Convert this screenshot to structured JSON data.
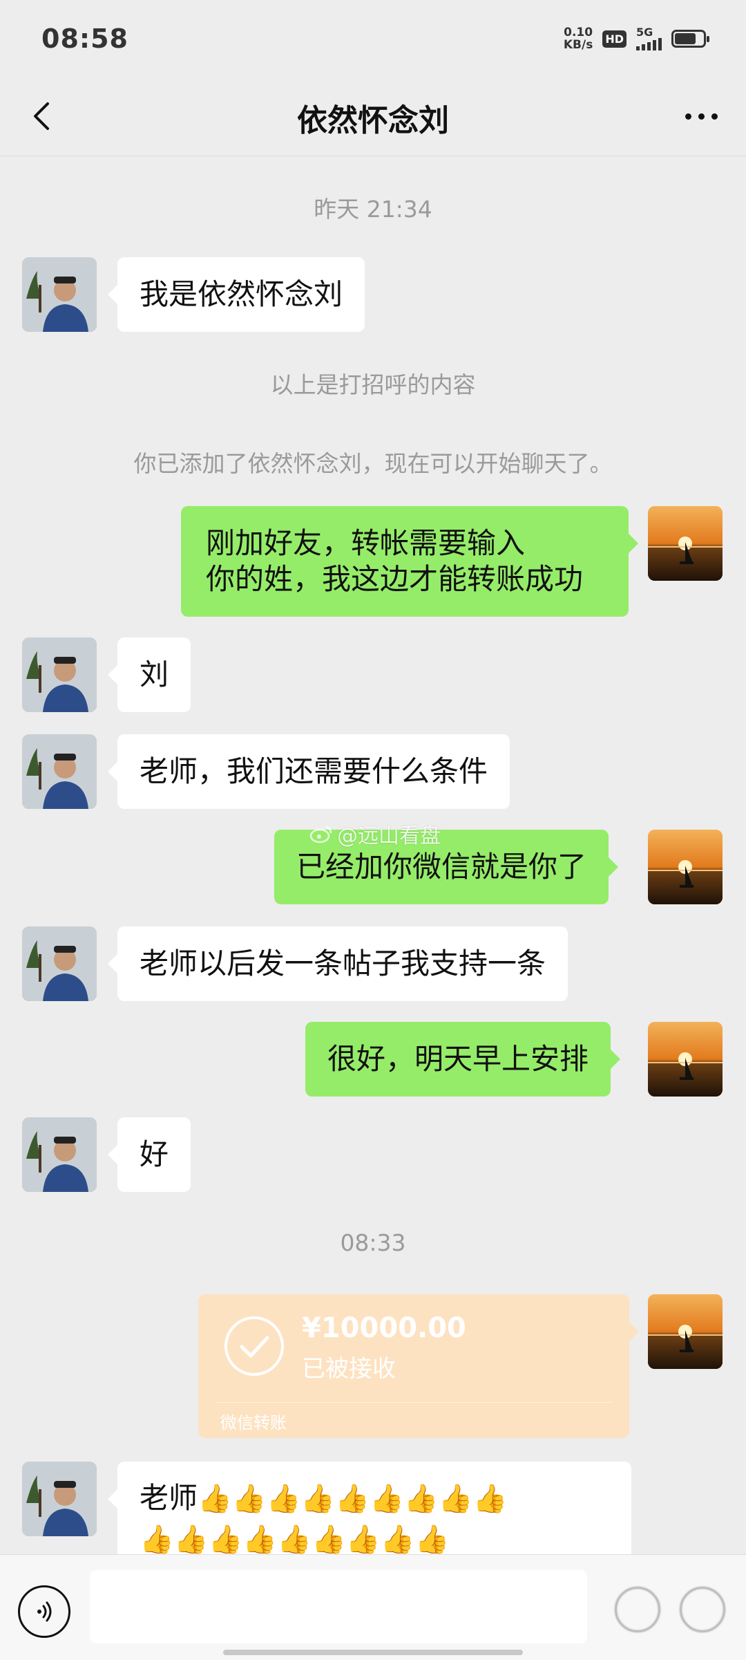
{
  "status_bar": {
    "time": "08:58",
    "net_speed_value": "0.10",
    "net_speed_unit": "KB/s",
    "hd_label": "HD",
    "network": "5G",
    "battery_level": 0.75
  },
  "nav": {
    "title": "依然怀念刘",
    "back_icon": "chevron-left-icon",
    "more_icon": "more-dots-icon"
  },
  "timestamps": {
    "first": "昨天 21:34",
    "second": "08:33"
  },
  "system_messages": {
    "greeting_note": "以上是打招呼的内容",
    "added_note": "你已添加了依然怀念刘，现在可以开始聊天了。"
  },
  "messages": [
    {
      "side": "in",
      "text": "我是依然怀念刘"
    },
    {
      "side": "out",
      "line1": "刚加好友，转帐需要输入",
      "line2": "你的姓，我这边才能转账成功"
    },
    {
      "side": "in",
      "text": "刘"
    },
    {
      "side": "in",
      "text": "老师，我们还需要什么条件"
    },
    {
      "side": "out",
      "text": "已经加你微信就是你了"
    },
    {
      "side": "in",
      "text": "老师以后发一条帖子我支持一条"
    },
    {
      "side": "out",
      "text": "很好，明天早上安排"
    },
    {
      "side": "in",
      "text": "好"
    },
    {
      "side": "in",
      "text": "老师",
      "emoji_line1": "👍👍👍👍👍👍👍👍👍",
      "emoji_line2": "👍👍👍👍👍👍👍👍👍"
    }
  ],
  "transfer": {
    "amount": "¥10000.00",
    "status": "已被接收",
    "label": "微信转账",
    "icon": "check-circle-icon",
    "color": "#fde2c2"
  },
  "watermark": {
    "text": "@远山看盘",
    "icon": "weibo-icon"
  },
  "colors": {
    "background": "#ededed",
    "incoming_bubble": "#ffffff",
    "outgoing_bubble": "#95ec69"
  },
  "input_bar": {
    "voice_icon": "voice-icon",
    "emoji_icon": "emoji-icon",
    "plus_icon": "plus-icon"
  }
}
